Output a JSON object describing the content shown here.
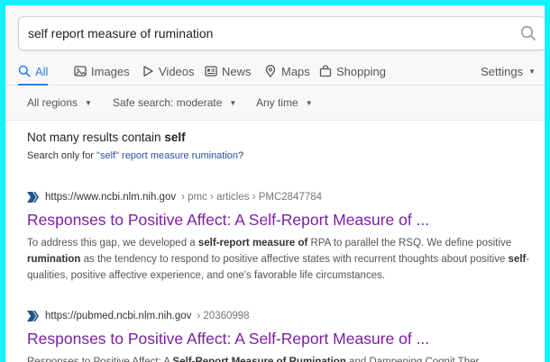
{
  "search": {
    "query": "self report measure of rumination"
  },
  "tabs": [
    {
      "label": "All",
      "icon": "search-icon",
      "active": true
    },
    {
      "label": "Images",
      "icon": "image-icon"
    },
    {
      "label": "Videos",
      "icon": "play-icon"
    },
    {
      "label": "News",
      "icon": "news-icon"
    },
    {
      "label": "Maps",
      "icon": "map-pin-icon"
    },
    {
      "label": "Shopping",
      "icon": "shopping-bag-icon"
    }
  ],
  "settings_label": "Settings",
  "filters": {
    "region": "All regions",
    "safe_search": "Safe search: moderate",
    "time": "Any time"
  },
  "notice": {
    "prefix": "Not many results contain ",
    "term": "self",
    "sub_prefix": "Search only for ",
    "sub_link": "\"self\" report measure rumination",
    "sub_suffix": "?"
  },
  "results": [
    {
      "host": "https://www.ncbi.nlm.nih.gov",
      "crumb": " › pmc › articles › PMC2847784",
      "title": "Responses to Positive Affect: A Self-Report Measure of ...",
      "snippet": [
        {
          "t": "To address this gap, we developed a "
        },
        {
          "t": "self-report measure of",
          "b": true
        },
        {
          "t": " RPA to parallel the RSQ. We define positive "
        },
        {
          "t": "rumination",
          "b": true
        },
        {
          "t": " as the tendency to respond to positive affective states with recurrent thoughts about positive "
        },
        {
          "t": "self",
          "b": true
        },
        {
          "t": "-qualities, positive affective experience, and one's favorable life circumstances."
        }
      ]
    },
    {
      "host": "https://pubmed.ncbi.nlm.nih.gov",
      "crumb": " › 20360998",
      "title": "Responses to Positive Affect: A Self-Report Measure of ...",
      "snippet": [
        {
          "t": "Responses to Positive Affect: A "
        },
        {
          "t": "Self-Report Measure of Rumination",
          "b": true
        },
        {
          "t": " and Dampening Cognit Ther"
        }
      ]
    }
  ]
}
